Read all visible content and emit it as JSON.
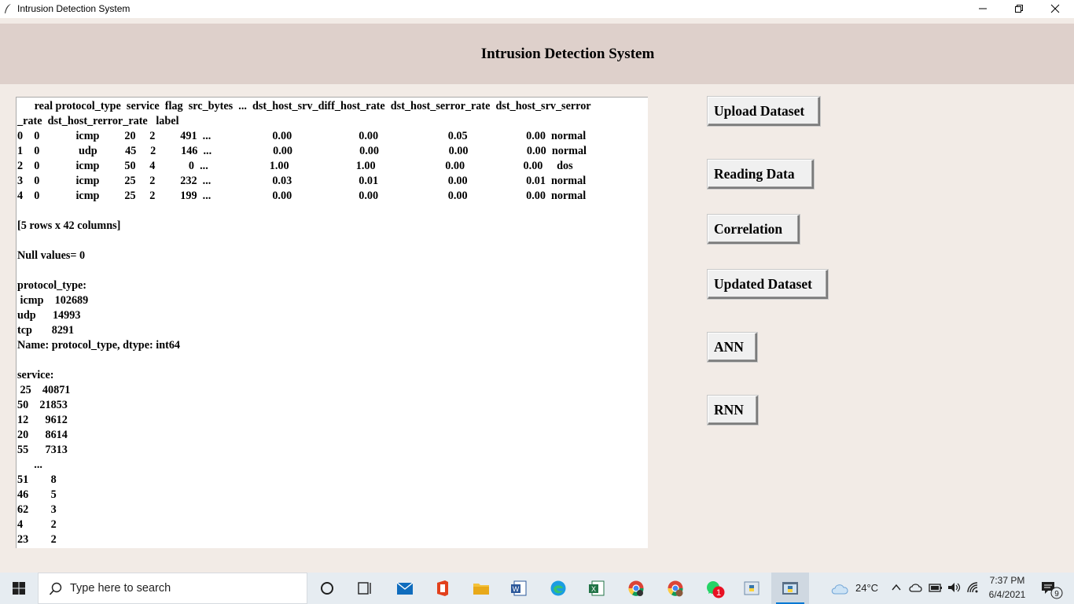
{
  "window": {
    "title": "Intrusion Detection System",
    "controls": {
      "minimize": "minimize",
      "maximize": "restore",
      "close": "close"
    }
  },
  "header": {
    "heading": "Intrusion Detection System"
  },
  "output": {
    "lines": [
      "   real protocol_type  service  flag  src_bytes  ...  dst_host_srv_diff_host_rate  dst_host_serror_rate  dst_host_srv_serror",
      "_rate  dst_host_rerror_rate   label",
      "0    0             icmp         20     2         491  ...                      0.00                        0.00                         0.05                     0.00  normal",
      "1    0              udp          45     2         146  ...                      0.00                        0.00                         0.00                     0.00  normal",
      "2    0             icmp         50     4            0  ...                      1.00                        1.00                         0.00                     0.00     dos",
      "3    0             icmp         25     2         232  ...                      0.03                        0.01                         0.00                     0.01  normal",
      "4    0             icmp         25     2         199  ...                      0.00                        0.00                         0.00                     0.00  normal",
      "",
      "[5 rows x 42 columns]",
      "",
      "Null values= 0",
      "",
      "protocol_type:",
      " icmp    102689",
      "udp      14993",
      "tcp       8291",
      "Name: protocol_type, dtype: int64",
      "",
      "service:",
      " 25    40871",
      "50    21853",
      "12      9612",
      "20      8614",
      "55      7313",
      "      ...",
      "51        8",
      "46        5",
      "62        3",
      "4          2",
      "23        2"
    ]
  },
  "buttons": {
    "upload": "Upload Dataset",
    "reading": "Reading Data",
    "correlation": "Correlation",
    "updated": "Updated Dataset",
    "ann": "ANN",
    "rnn": "RNN"
  },
  "taskbar": {
    "search_placeholder": "Type here to search",
    "weather": "24°C",
    "time": "7:37 PM",
    "date": "6/4/2021",
    "notification_count": "9",
    "badge_count": "1",
    "accent": "#0078d4"
  }
}
